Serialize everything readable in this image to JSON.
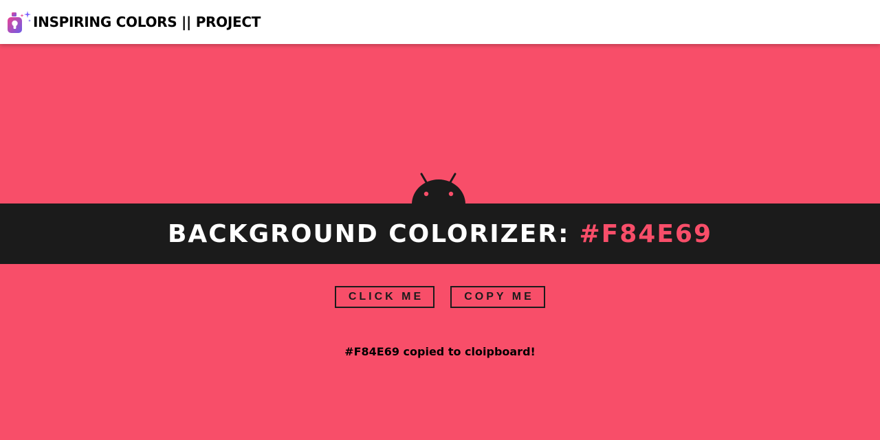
{
  "navbar": {
    "logo_icon": "paint-bottle-sparkle-icon",
    "brand_title": "INSPIRING COLORS || PROJECT"
  },
  "main": {
    "mascot_icon": "android-head-icon",
    "banner_label": "BACKGROUND COLORIZER:",
    "current_hex": "#F84E69",
    "buttons": {
      "click_label": "CLICK ME",
      "copy_label": "COPY ME"
    },
    "status_message": "#F84E69 copied to cloipboard!"
  },
  "colors": {
    "page_background": "#F84E69",
    "banner_background": "#1B1B1B",
    "banner_text": "#FFFFFF",
    "accent_hex_text": "#F84E69",
    "navbar_background": "#FFFFFF"
  }
}
